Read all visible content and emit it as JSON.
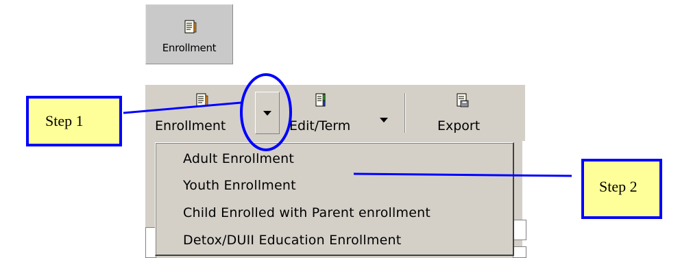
{
  "top_button": {
    "label": "Enrollment",
    "icon": "document-pencil-icon"
  },
  "toolbar": {
    "enrollment": {
      "label": "Enrollment",
      "icon": "document-pencil-icon"
    },
    "edit_term": {
      "label": "Edit/Term",
      "icon": "document-edit-icon"
    },
    "export": {
      "label": "Export",
      "icon": "document-export-icon"
    }
  },
  "menu": {
    "items": [
      "Adult Enrollment",
      "Youth Enrollment",
      "Child Enrolled with Parent enrollment",
      "Detox/DUII Education Enrollment"
    ]
  },
  "callouts": {
    "step1": "Step 1",
    "step2": "Step 2"
  },
  "colors": {
    "annotation": "#0000ff",
    "callout_fill": "#ffff99",
    "toolbar_bg": "#d4d0c8"
  }
}
